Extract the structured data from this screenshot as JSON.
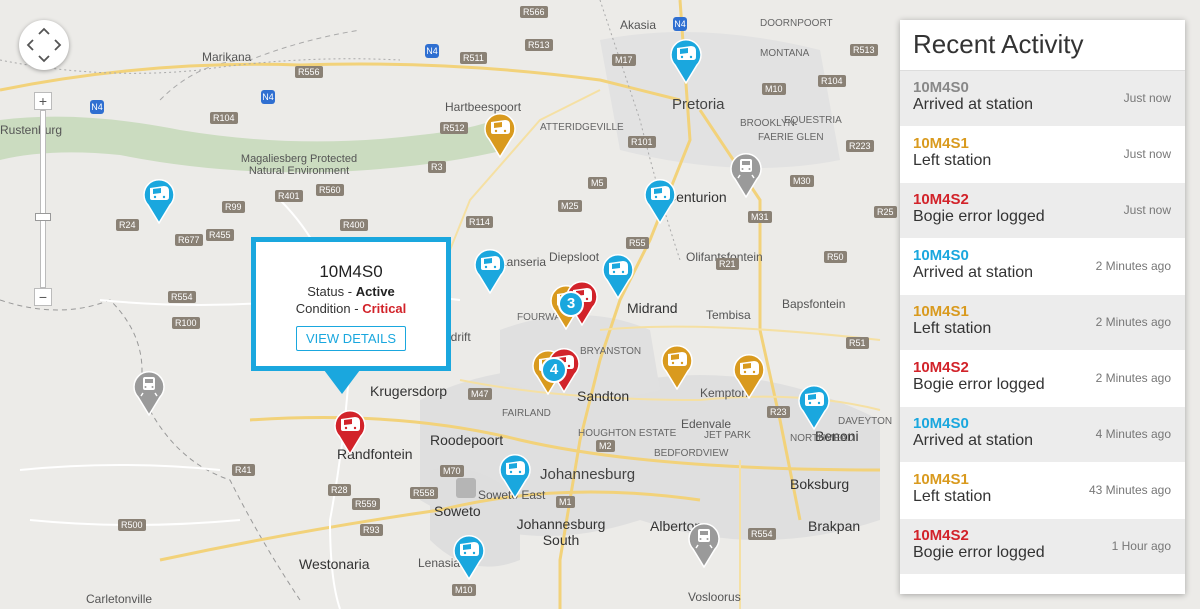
{
  "colors": {
    "blue": "#1aa7de",
    "amber": "#d99a1e",
    "red": "#d2232a",
    "grey": "#8b8b8b",
    "station": "#9a9a9a"
  },
  "popup": {
    "title": "10M4S0",
    "status_label": "Status - ",
    "status_value": "Active",
    "condition_label": "Condition - ",
    "condition_value": "Critical",
    "button": "VIEW DETAILS"
  },
  "zoom": {
    "plus": "+",
    "minus": "−"
  },
  "activity": {
    "title": "Recent Activity",
    "items": [
      {
        "id": "10M4S0",
        "message": "Arrived at station",
        "time": "Just now",
        "color": "#888888",
        "bg": "grey"
      },
      {
        "id": "10M4S1",
        "message": "Left station",
        "time": "Just now",
        "color": "#d99a1e",
        "bg": "white"
      },
      {
        "id": "10M4S2",
        "message": "Bogie error logged",
        "time": "Just now",
        "color": "#d2232a",
        "bg": "grey"
      },
      {
        "id": "10M4S0",
        "message": "Arrived at station",
        "time": "2 Minutes ago",
        "color": "#1aa7de",
        "bg": "white"
      },
      {
        "id": "10M4S1",
        "message": "Left station",
        "time": "2 Minutes ago",
        "color": "#d99a1e",
        "bg": "grey"
      },
      {
        "id": "10M4S2",
        "message": "Bogie error logged",
        "time": "2 Minutes ago",
        "color": "#d2232a",
        "bg": "white"
      },
      {
        "id": "10M4S0",
        "message": "Arrived at station",
        "time": "4 Minutes ago",
        "color": "#1aa7de",
        "bg": "grey"
      },
      {
        "id": "10M4S1",
        "message": "Left station",
        "time": "43 Minutes ago",
        "color": "#d99a1e",
        "bg": "white"
      },
      {
        "id": "10M4S2",
        "message": "Bogie error logged",
        "time": "1 Hour ago",
        "color": "#d2232a",
        "bg": "grey"
      }
    ]
  },
  "clusters": [
    "3",
    "4"
  ],
  "map_labels": {
    "pretoria": "Pretoria",
    "centurion": "Centurion",
    "midrand": "Midrand",
    "sandton": "Sandton",
    "johannesburg": "Johannesburg",
    "roodepoort": "Roodepoort",
    "randfontein": "Randfontein",
    "krugersdorp": "Krugersdorp",
    "soweto": "Soweto",
    "westonaria": "Westonaria",
    "carletonville": "Carletonville",
    "jhb_south": "Johannesburg South",
    "alberton": "Alberton",
    "boksburg": "Boksburg",
    "benoni": "Benoni",
    "brakpan": "Brakpan",
    "hartbeespoort": "Hartbeespoort",
    "magaliesberg": "Magaliesberg Protected Natural Environment",
    "rustenburg": "Rustenburg",
    "marikana": "Marikana",
    "akasia": "Akasia",
    "tembisa": "Tembisa",
    "edenvale": "Edenvale",
    "kempton": "Kempton",
    "olifantsfontein": "Olifantsfontein",
    "bapsfontein": "Bapsfontein",
    "vosloorus": "Vosloorus",
    "lenasia": "Lenasia",
    "fourways": "FOURWAYS",
    "diepsloot": "Diepsloot",
    "brooklyn": "BROOKLYN",
    "faerie_glen": "FAERIE GLEN",
    "equestria": "EQUESTRIA",
    "doornpoort": "DOORNPOORT",
    "montana": "MONTANA",
    "bryanston": "BRYANSTON",
    "houghton": "HOUGHTON ESTATE",
    "bedfordview": "BEDFORDVIEW",
    "northmead": "NORTHMEAD",
    "jet_park": "JET PARK",
    "daveyton": "DAVEYTON",
    "fairland": "FAIRLAND",
    "muldersdrift": "Muldersdrift",
    "lanseria": "Lanseria",
    "soweto_east": "Soweto East",
    "attridgeville": "ATTERIDGEVILLE"
  },
  "road_badges": [
    "R566",
    "R513",
    "R511",
    "R556",
    "N4",
    "R104",
    "R512",
    "R3",
    "R560",
    "R401",
    "R24",
    "R677",
    "R455",
    "R99",
    "R554",
    "R100",
    "R400",
    "R114",
    "R28",
    "R41",
    "R559",
    "R558",
    "R500",
    "R93",
    "R554",
    "M10",
    "M17",
    "M5",
    "M25",
    "R55",
    "R101",
    "R21",
    "R23",
    "R25",
    "R51",
    "R50",
    "M31",
    "R513",
    "R104",
    "M10",
    "R223",
    "M30",
    "M1",
    "M47",
    "M70",
    "M2"
  ]
}
